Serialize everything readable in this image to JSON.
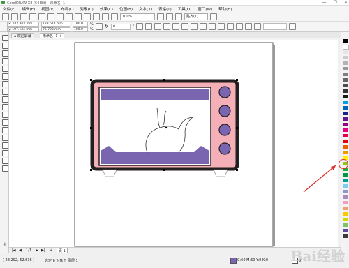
{
  "window": {
    "title": "CorelDRAW X8 (64-Bit) - 未命名 -1",
    "controls": [
      "—",
      "☐",
      "✕"
    ]
  },
  "menu": [
    "文件(F)",
    "编辑(E)",
    "视图(V)",
    "布局(L)",
    "对象(C)",
    "效果(C)",
    "位图(B)",
    "文本(X)",
    "表格(T)",
    "工具(O)",
    "窗口(W)",
    "帮助(H)"
  ],
  "toolbar": {
    "zoom": "100%",
    "snap_label": "贴齐(T)"
  },
  "propbar": {
    "x": "107.302 mm",
    "y": "107.134 mm",
    "w": "123.677 mm",
    "h": "76.723 mm",
    "sx": "100.0",
    "sy": "100.0",
    "pct": "%",
    "angle": ".0",
    "degree": "°"
  },
  "tabs": [
    "欢迎屏幕",
    "未命名 -1"
  ],
  "page_nav": {
    "page_label": "页 1",
    "count": "1/1"
  },
  "status": {
    "coords": "( 28.292, 52.636 )",
    "selection": "选定 6 对象于 图层 1",
    "fill_info": "C:60 M:60 Y:0 K:0",
    "outline_info": "无"
  },
  "colors": {
    "oven_body": "#f4b0b6",
    "oven_outline": "#231f20",
    "purple": "#7a66b0",
    "knob": "#7a66b0",
    "accent_red": "#e03030"
  },
  "palette": [
    "#000000",
    "#ffffff",
    "#e6e6e6",
    "#cccccc",
    "#b3b3b3",
    "#999999",
    "#808080",
    "#666666",
    "#4d4d4d",
    "#333333",
    "#1a1a1a",
    "#00a0e9",
    "#0068b7",
    "#1d2088",
    "#601986",
    "#920783",
    "#e4007f",
    "#e5004f",
    "#e60012",
    "#eb6100",
    "#f39800",
    "#fff100",
    "#8fc31f",
    "#22ac38",
    "#009944",
    "#009e96",
    "#7ecef4",
    "#8c97cb",
    "#aa89bd",
    "#f19ec2",
    "#f29b76",
    "#fcc800",
    "#cfdb00",
    "#80c269",
    "#5a4b9c",
    "#3e3a39"
  ],
  "watermark": "Bai经验"
}
